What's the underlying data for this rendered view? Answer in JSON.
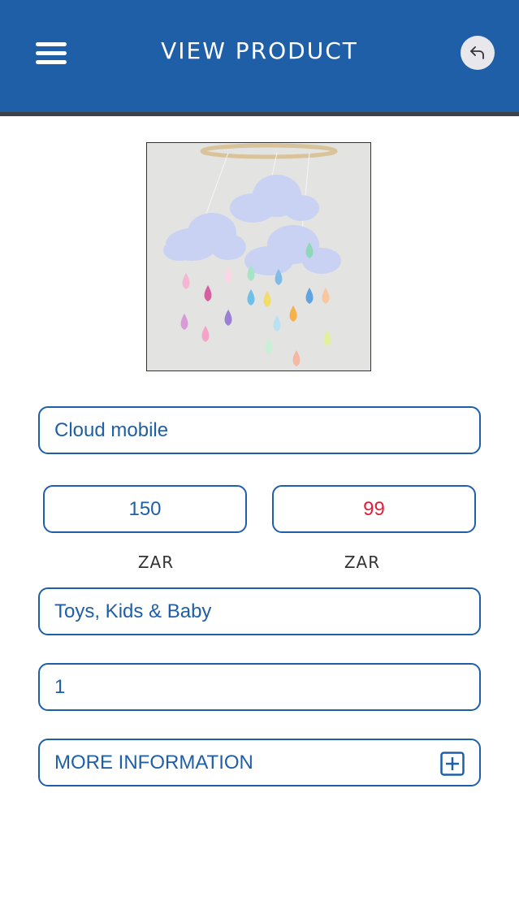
{
  "header": {
    "title": "VIEW PRODUCT",
    "menu_icon": "hamburger-menu-icon",
    "back_icon": "back-arrow-icon",
    "color": "#1f5fa8"
  },
  "product": {
    "image_alt": "Cloud mobile",
    "name": "Cloud mobile",
    "price": "150",
    "sale_price": "99",
    "price_currency": "ZAR",
    "sale_currency": "ZAR",
    "category": "Toys, Kids & Baby",
    "quantity": "1"
  },
  "more_info": {
    "label": "MORE INFORMATION",
    "icon": "plus-square-icon"
  },
  "colors": {
    "accent": "#1f5fa8",
    "sale": "#e0203a"
  }
}
